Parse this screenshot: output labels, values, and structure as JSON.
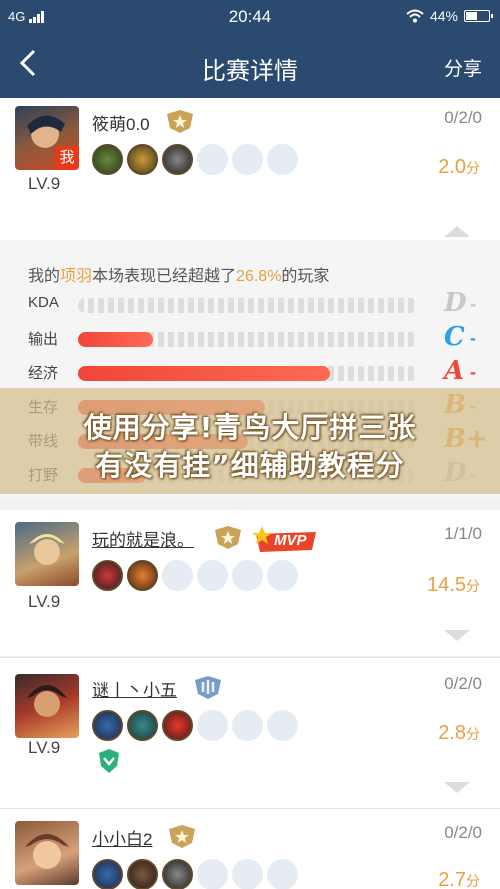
{
  "status": {
    "network": "4G",
    "time": "20:44",
    "battery": "44%"
  },
  "nav": {
    "title": "比赛详情",
    "share": "分享"
  },
  "players": [
    {
      "name": "筱萌0.0",
      "level": "LV.9",
      "kda": "0/2/0",
      "score": "2.0",
      "unit": "分",
      "badge": "我"
    },
    {
      "name": "玩的就是浪。",
      "level": "LV.9",
      "kda": "1/1/0",
      "score": "14.5",
      "unit": "分",
      "mvp": "MVP"
    },
    {
      "name": "谜丨丶小五",
      "level": "LV.9",
      "kda": "0/2/0",
      "score": "2.8",
      "unit": "分"
    },
    {
      "name": "小小白2",
      "level": "LV.9",
      "kda": "0/2/0",
      "score": "2.7",
      "unit": "分"
    }
  ],
  "detail": {
    "prefix": "我的",
    "hero": "项羽",
    "middle": "本场表现已经超越了",
    "percent": "26.8%",
    "suffix": "的玩家",
    "stats": [
      {
        "label": "KDA",
        "fill": 0.0,
        "grade": "D",
        "color": "#c8c8c8"
      },
      {
        "label": "输出",
        "fill": 0.22,
        "grade": "C",
        "color": "#2aa0e6"
      },
      {
        "label": "经济",
        "fill": 0.74,
        "grade": "A",
        "color": "#f0453a"
      },
      {
        "label": "生存",
        "fill": 0.55,
        "grade": "B",
        "color": "#e8a040"
      },
      {
        "label": "带线",
        "fill": 0.5,
        "grade": "B+",
        "color": "#e8a040"
      },
      {
        "label": "打野",
        "fill": 0.2,
        "grade": "D",
        "color": "#c8c8c8"
      }
    ]
  },
  "overlay": {
    "line1": "使用分享!青鸟大厅拼三张",
    "line2": "有没有挂”细辅助教程分"
  }
}
